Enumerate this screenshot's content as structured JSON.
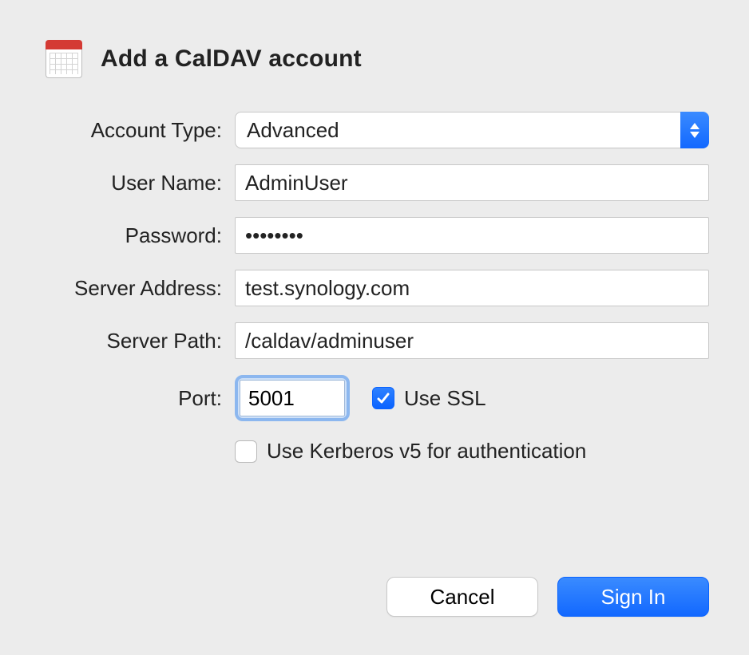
{
  "header": {
    "title": "Add a CalDAV account"
  },
  "labels": {
    "account_type": "Account Type:",
    "user_name": "User Name:",
    "password": "Password:",
    "server_address": "Server Address:",
    "server_path": "Server Path:",
    "port": "Port:"
  },
  "fields": {
    "account_type_value": "Advanced",
    "user_name_value": "AdminUser",
    "password_value": "••••••••",
    "server_address_value": "test.synology.com",
    "server_path_value": "/caldav/adminuser",
    "port_value": "5001"
  },
  "checkboxes": {
    "use_ssl_label": "Use SSL",
    "use_ssl_checked": true,
    "kerberos_label": "Use Kerberos v5 for authentication",
    "kerberos_checked": false
  },
  "buttons": {
    "cancel": "Cancel",
    "sign_in": "Sign In"
  }
}
